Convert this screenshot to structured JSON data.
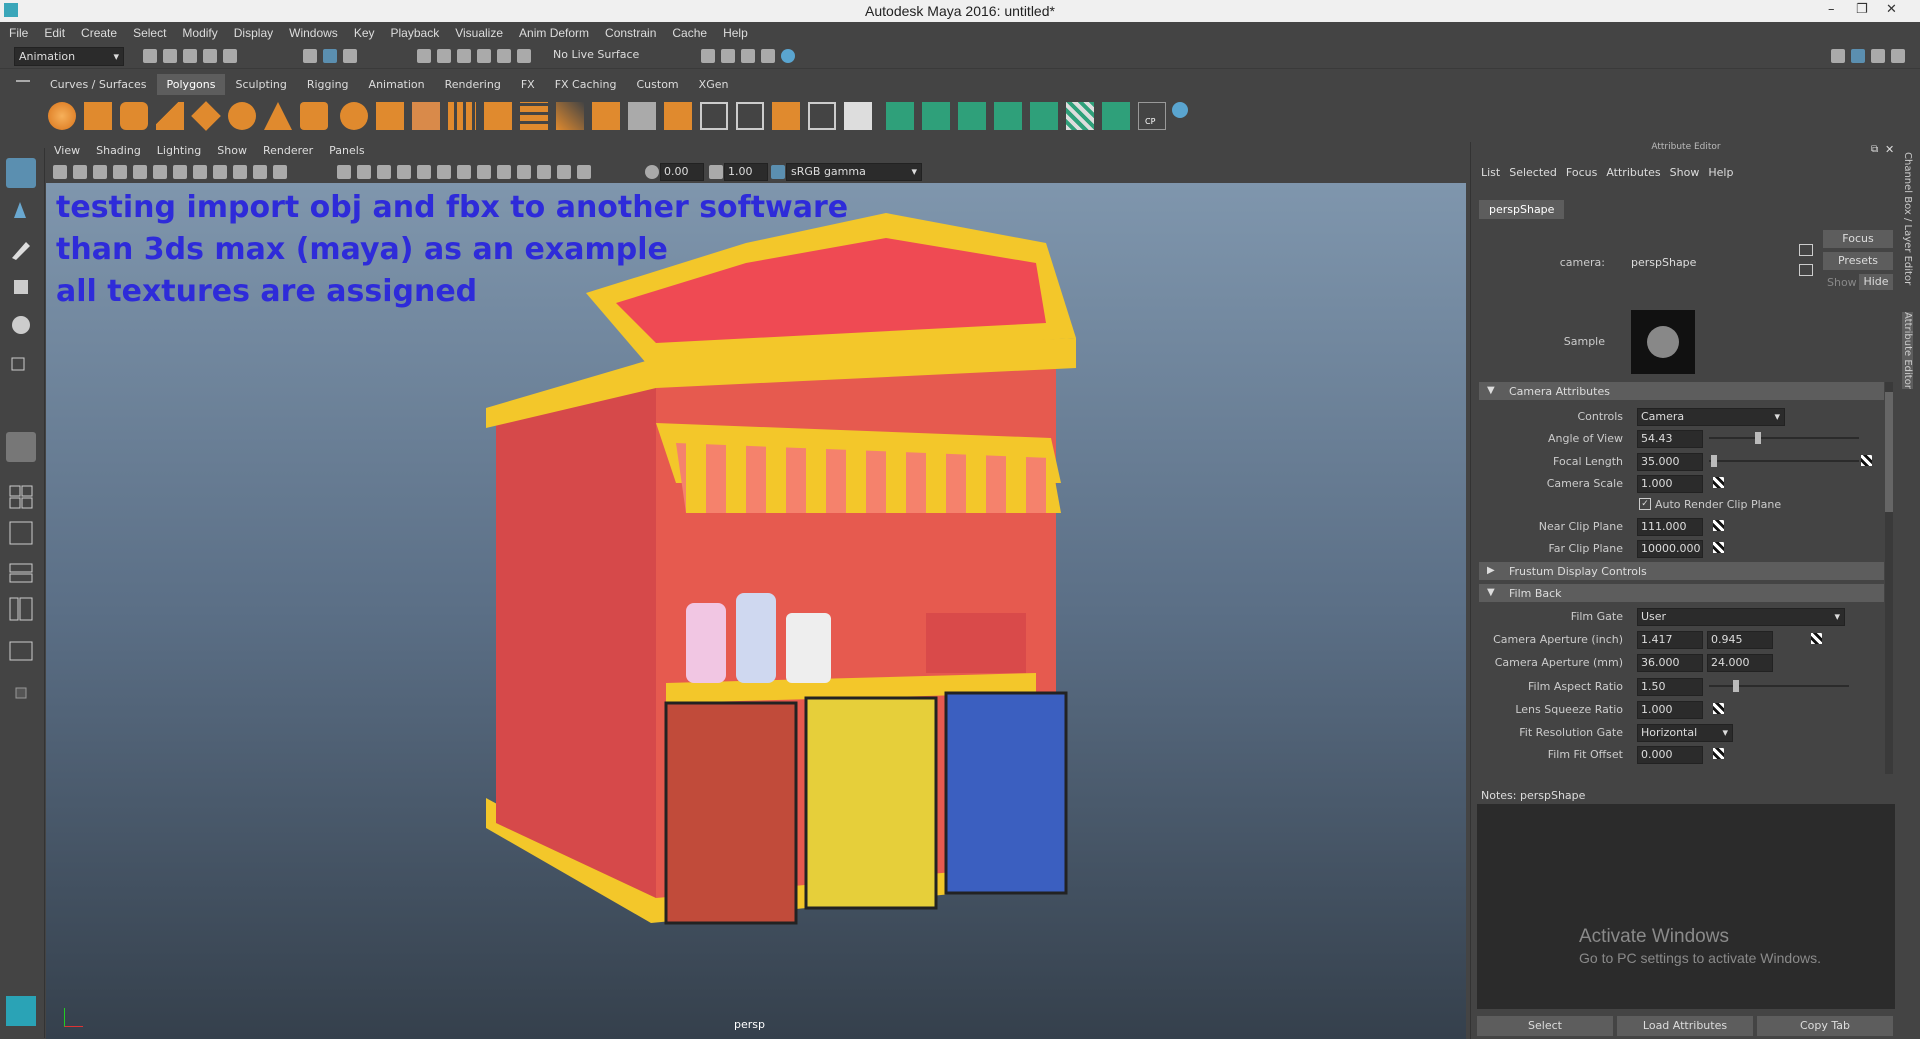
{
  "window": {
    "title": "Autodesk Maya 2016: untitled*",
    "controls": [
      "–",
      "❐",
      "✕"
    ]
  },
  "menubar": [
    "File",
    "Edit",
    "Create",
    "Select",
    "Modify",
    "Display",
    "Windows",
    "Key",
    "Playback",
    "Visualize",
    "Anim Deform",
    "Constrain",
    "Cache",
    "Help"
  ],
  "statusline": {
    "mode": "Animation",
    "live_surface": "No Live Surface"
  },
  "shelf_tabs": [
    "Curves / Surfaces",
    "Polygons",
    "Sculpting",
    "Rigging",
    "Animation",
    "Rendering",
    "FX",
    "FX Caching",
    "Custom",
    "XGen"
  ],
  "shelf_active": "Polygons",
  "shelf_cp_label": "CP",
  "viewport": {
    "menu": [
      "View",
      "Shading",
      "Lighting",
      "Show",
      "Renderer",
      "Panels"
    ],
    "exposure": "0.00",
    "gamma": "1.00",
    "color_space": "sRGB gamma",
    "camera_label": "persp",
    "annotation": [
      "testing import obj and fbx to another software",
      "than 3ds max (maya) as an example",
      "all textures are assigned"
    ]
  },
  "attribute_editor": {
    "header": "Attribute Editor",
    "menu": [
      "List",
      "Selected",
      "Focus",
      "Attributes",
      "Show",
      "Help"
    ],
    "tab": "perspShape",
    "camera_label": "camera:",
    "camera_value": "perspShape",
    "focus_btn": "Focus",
    "presets_btn": "Presets",
    "show_btn": "Show",
    "hide_btn": "Hide",
    "sample_label": "Sample",
    "sections": {
      "camera_attributes": "Camera Attributes",
      "frustum": "Frustum Display Controls",
      "film_back": "Film Back"
    },
    "fields": {
      "controls_label": "Controls",
      "controls_value": "Camera",
      "aov_label": "Angle of View",
      "aov_value": "54.43",
      "focal_label": "Focal Length",
      "focal_value": "35.000",
      "scale_label": "Camera Scale",
      "scale_value": "1.000",
      "auto_clip_label": "Auto Render Clip Plane",
      "near_label": "Near Clip Plane",
      "near_value": "111.000",
      "far_label": "Far Clip Plane",
      "far_value": "10000.000",
      "film_gate_label": "Film Gate",
      "film_gate_value": "User",
      "ap_inch_label": "Camera Aperture (inch)",
      "ap_inch_w": "1.417",
      "ap_inch_h": "0.945",
      "ap_mm_label": "Camera Aperture (mm)",
      "ap_mm_w": "36.000",
      "ap_mm_h": "24.000",
      "aspect_label": "Film Aspect Ratio",
      "aspect_value": "1.50",
      "squeeze_label": "Lens Squeeze Ratio",
      "squeeze_value": "1.000",
      "fit_gate_label": "Fit Resolution Gate",
      "fit_gate_value": "Horizontal",
      "fit_offset_label": "Film Fit Offset",
      "fit_offset_value": "0.000"
    },
    "notes_label": "Notes:  perspShape",
    "activate_title": "Activate Windows",
    "activate_sub": "Go to PC settings to activate Windows.",
    "bottom_buttons": [
      "Select",
      "Load Attributes",
      "Copy Tab"
    ]
  },
  "side_tabs": [
    "Channel Box / Layer Editor",
    "Attribute Editor"
  ],
  "colors": {
    "annotation": "#2e2bd9",
    "panel": "#444444",
    "field": "#2b2b2b",
    "highlight": "#5d5d5d"
  }
}
